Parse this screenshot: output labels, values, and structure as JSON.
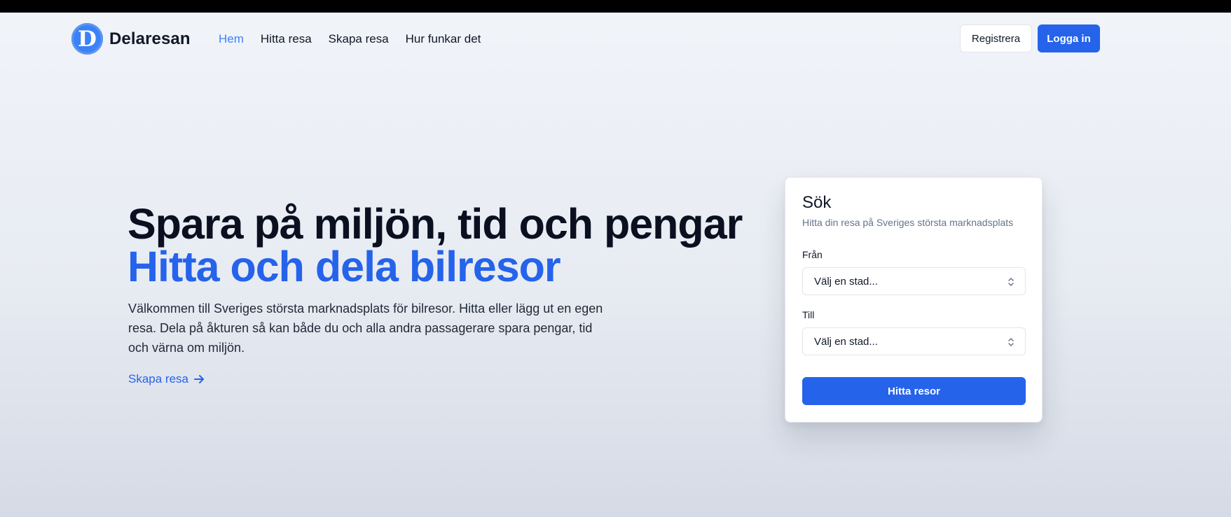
{
  "header": {
    "brand_letter": "D",
    "brand_name": "Delaresan",
    "nav": [
      {
        "label": "Hem",
        "active": true
      },
      {
        "label": "Hitta resa",
        "active": false
      },
      {
        "label": "Skapa resa",
        "active": false
      },
      {
        "label": "Hur funkar det",
        "active": false
      }
    ],
    "register_label": "Registrera",
    "login_label": "Logga in"
  },
  "hero": {
    "title_line1": "Spara på miljön, tid och pengar",
    "title_line2": "Hitta och dela bilresor",
    "description": "Välkommen till Sveriges största marknadsplats för bilresor. Hitta eller lägg ut en egen resa. Dela på åkturen så kan både du och alla andra passagerare spara pengar, tid och värna om miljön.",
    "cta_label": "Skapa resa",
    "cta_icon": "arrow-right-icon"
  },
  "search": {
    "title": "Sök",
    "subtitle": "Hitta din resa på Sveriges största marknadsplats",
    "from_label": "Från",
    "from_value": "Välj en stad...",
    "to_label": "Till",
    "to_value": "Välj en stad...",
    "submit_label": "Hitta resor"
  },
  "colors": {
    "accent": "#2563eb",
    "logo": "#3b82f6",
    "heading": "#0b1021",
    "muted": "#64748b"
  }
}
